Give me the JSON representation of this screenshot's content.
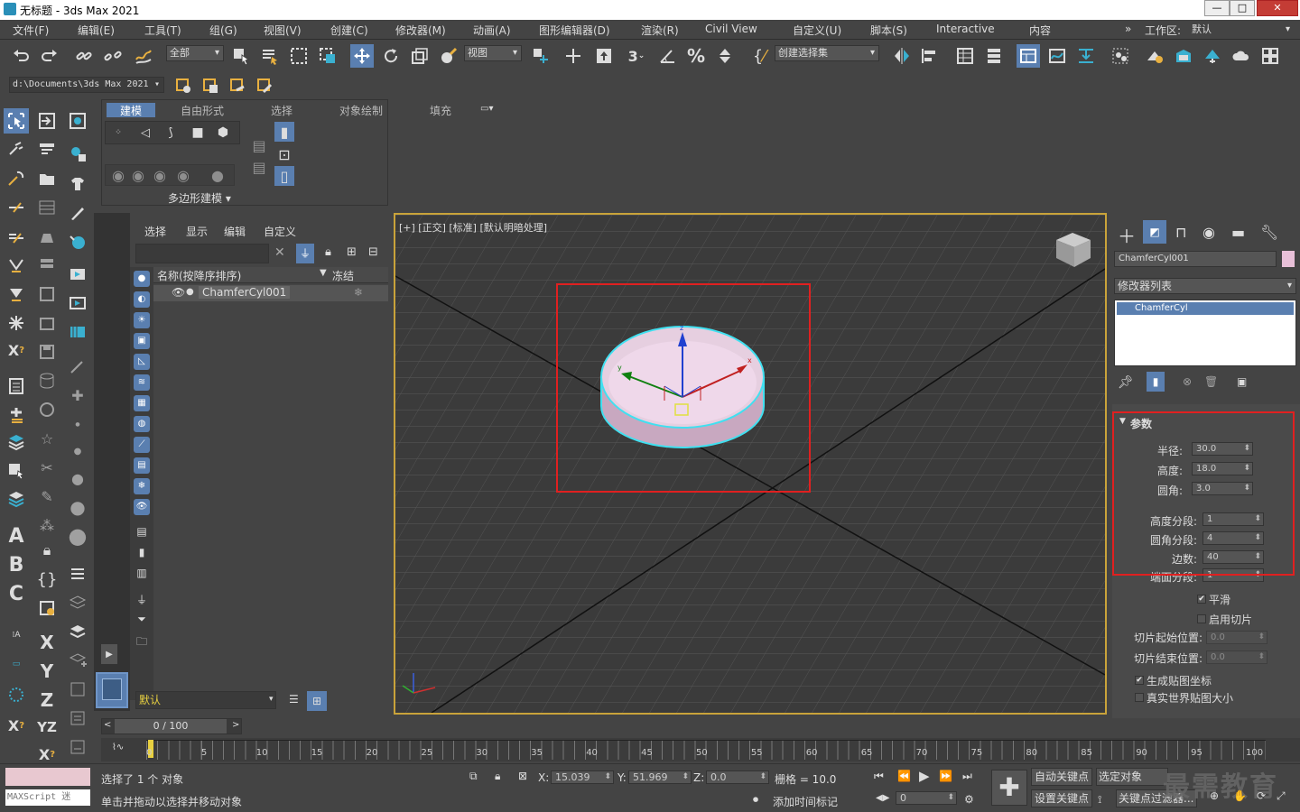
{
  "window": {
    "title": "无标题 - 3ds Max 2021",
    "min": "—",
    "max": "□",
    "close": "✕"
  },
  "menu": [
    "文件(F)",
    "编辑(E)",
    "工具(T)",
    "组(G)",
    "视图(V)",
    "创建(C)",
    "修改器(M)",
    "动画(A)",
    "图形编辑器(D)",
    "渲染(R)",
    "Civil View",
    "自定义(U)",
    "脚本(S)",
    "Interactive",
    "内容"
  ],
  "workspace": {
    "label": "工作区:",
    "value": "默认"
  },
  "toolbar": {
    "filter": "全部",
    "refcoord": "视图",
    "selset": "创建选择集"
  },
  "path": "d:\\Documents\\3ds Max 2021",
  "ribbon": {
    "tabs": [
      "建模",
      "自由形式",
      "选择",
      "对象绘制",
      "填充"
    ],
    "panel_label": "多边形建模"
  },
  "scene": {
    "tabs": [
      "选择",
      "显示",
      "编辑",
      "自定义"
    ],
    "col_name": "名称(按降序排序)",
    "col_freeze": "冻结",
    "items": [
      {
        "name": "ChamferCyl001"
      }
    ],
    "layer": "默认"
  },
  "viewport": {
    "label": "[+] [正交] [标准] [默认明暗处理]"
  },
  "cmd": {
    "object_name": "ChamferCyl001",
    "modlist": "修改器列表",
    "stack": [
      "ChamferCyl"
    ]
  },
  "params": {
    "header": "参数",
    "rows": [
      {
        "label": "半径:",
        "value": "30.0"
      },
      {
        "label": "高度:",
        "value": "18.0"
      },
      {
        "label": "圆角:",
        "value": "3.0"
      }
    ],
    "seg_rows": [
      {
        "label": "高度分段:",
        "value": "1"
      },
      {
        "label": "圆角分段:",
        "value": "4"
      },
      {
        "label": "边数:",
        "value": "40"
      },
      {
        "label": "端面分段:",
        "value": "1"
      }
    ],
    "smooth": "平滑",
    "slice_on": "启用切片",
    "slice_from": {
      "label": "切片起始位置:",
      "value": "0.0"
    },
    "slice_to": {
      "label": "切片结束位置:",
      "value": "0.0"
    },
    "gen_map": "生成贴图坐标",
    "real_world": "真实世界贴图大小"
  },
  "timeline": {
    "frame": "0 / 100",
    "ticks": [
      "0",
      "5",
      "10",
      "15",
      "20",
      "25",
      "30",
      "35",
      "40",
      "45",
      "50",
      "55",
      "60",
      "65",
      "70",
      "75",
      "80",
      "85",
      "90",
      "95",
      "100"
    ]
  },
  "status": {
    "selected": "选择了 1 个 对象",
    "prompt": "单击并拖动以选择并移动对象",
    "script": "MAXScript 迷",
    "x_label": "X:",
    "x": "15.039",
    "y_label": "Y:",
    "y": "51.969",
    "z_label": "Z:",
    "z": "0.0",
    "grid": "栅格 = 10.0",
    "add_time": "添加时间标记",
    "auto_key": "自动关键点",
    "set_key": "设置关键点",
    "sel_obj": "选定对象",
    "key_filter": "关键点过滤器...",
    "frame_field": "0"
  },
  "watermark": "最需教育"
}
